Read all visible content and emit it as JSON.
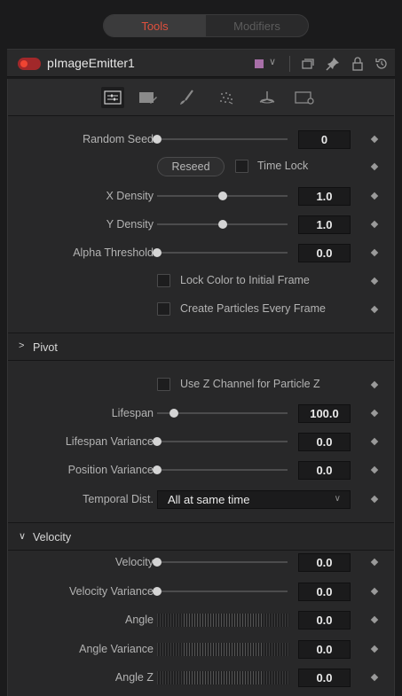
{
  "tabs": {
    "tools": "Tools",
    "modifiers": "Modifiers"
  },
  "node": {
    "name": "pImageEmitter1",
    "color": "#a86fa8",
    "enabled": true
  },
  "header_icons": [
    "chevron-down-icon",
    "versions-icon",
    "pin-icon",
    "lock-icon",
    "reset-icon"
  ],
  "icon_tabs": [
    "controls-tab",
    "sets-tab",
    "style-tab",
    "region-tab",
    "image-tab",
    "settings-tab"
  ],
  "controls": {
    "random_seed": {
      "label": "Random Seed",
      "value": "0",
      "slider": 0.0
    },
    "reseed": "Reseed",
    "time_lock": {
      "label": "Time Lock",
      "checked": false
    },
    "x_density": {
      "label": "X Density",
      "value": "1.0",
      "slider": 0.5
    },
    "y_density": {
      "label": "Y Density",
      "value": "1.0",
      "slider": 0.5
    },
    "alpha_threshold": {
      "label": "Alpha Threshold",
      "value": "0.0",
      "slider": 0.0
    },
    "lock_color": {
      "label": "Lock Color to Initial Frame",
      "checked": false
    },
    "create_particles": {
      "label": "Create Particles Every Frame",
      "checked": false
    }
  },
  "pivot": {
    "title": "Pivot",
    "expanded": false
  },
  "lifespan_group": {
    "use_z": {
      "label": "Use Z Channel for Particle Z",
      "checked": false
    },
    "lifespan": {
      "label": "Lifespan",
      "value": "100.0",
      "slider": 0.1
    },
    "lifespan_variance": {
      "label": "Lifespan Variance",
      "value": "0.0",
      "slider": 0.0
    },
    "position_variance": {
      "label": "Position Variance",
      "value": "0.0",
      "slider": 0.0
    },
    "temporal_dist": {
      "label": "Temporal Dist.",
      "value": "All at same time"
    }
  },
  "velocity": {
    "title": "Velocity",
    "expanded": true,
    "velocity": {
      "label": "Velocity",
      "value": "0.0",
      "slider": 0.0
    },
    "velocity_variance": {
      "label": "Velocity Variance",
      "value": "0.0",
      "slider": 0.0
    },
    "angle": {
      "label": "Angle",
      "value": "0.0"
    },
    "angle_variance": {
      "label": "Angle Variance",
      "value": "0.0"
    },
    "angle_z": {
      "label": "Angle Z",
      "value": "0.0"
    }
  }
}
